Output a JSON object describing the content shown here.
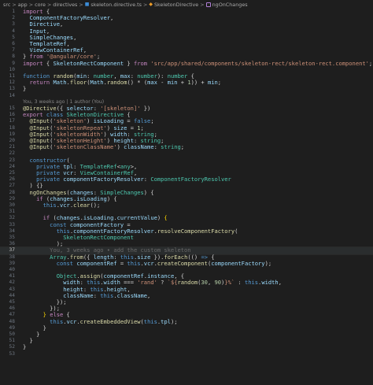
{
  "breadcrumb": {
    "items": [
      "src",
      "app",
      "core",
      "directives",
      "skeleton.directive.ts",
      "SkeletonDirective",
      "ngOnChanges"
    ],
    "separator": ">"
  },
  "blame": {
    "text": "You, 3 weeks ago | 1 author (You)"
  },
  "lines": [
    {
      "n": "1",
      "t": [
        [
          "kw",
          "import"
        ],
        [
          "pl",
          " {"
        ]
      ]
    },
    {
      "n": "2",
      "t": [
        [
          "pl",
          "  "
        ],
        [
          "var",
          "ComponentFactoryResolver"
        ],
        [
          "pl",
          ","
        ]
      ]
    },
    {
      "n": "3",
      "t": [
        [
          "pl",
          "  "
        ],
        [
          "var",
          "Directive"
        ],
        [
          "pl",
          ","
        ]
      ]
    },
    {
      "n": "4",
      "t": [
        [
          "pl",
          "  "
        ],
        [
          "var",
          "Input"
        ],
        [
          "pl",
          ","
        ]
      ]
    },
    {
      "n": "5",
      "t": [
        [
          "pl",
          "  "
        ],
        [
          "var",
          "SimpleChanges"
        ],
        [
          "pl",
          ","
        ]
      ]
    },
    {
      "n": "6",
      "t": [
        [
          "pl",
          "  "
        ],
        [
          "var",
          "TemplateRef"
        ],
        [
          "pl",
          ","
        ]
      ]
    },
    {
      "n": "7",
      "t": [
        [
          "pl",
          "  "
        ],
        [
          "var",
          "ViewContainerRef"
        ],
        [
          "pl",
          ","
        ]
      ]
    },
    {
      "n": "8",
      "t": [
        [
          "pl",
          "} "
        ],
        [
          "kw",
          "from"
        ],
        [
          "pl",
          " "
        ],
        [
          "str",
          "'@angular/core'"
        ],
        [
          "pl",
          ";"
        ]
      ]
    },
    {
      "n": "9",
      "t": [
        [
          "kw",
          "import"
        ],
        [
          "pl",
          " { "
        ],
        [
          "var",
          "SkeletonRectComponent"
        ],
        [
          "pl",
          " } "
        ],
        [
          "kw",
          "from"
        ],
        [
          "pl",
          " "
        ],
        [
          "str",
          "'src/app/shared/components/skeleton-rect/skeleton-rect.component'"
        ],
        [
          "pl",
          ";"
        ]
      ]
    },
    {
      "n": "10",
      "t": []
    },
    {
      "n": "11",
      "t": [
        [
          "kw2",
          "function"
        ],
        [
          "pl",
          " "
        ],
        [
          "fn",
          "random"
        ],
        [
          "pl",
          "("
        ],
        [
          "var",
          "min"
        ],
        [
          "pl",
          ": "
        ],
        [
          "ty",
          "number"
        ],
        [
          "pl",
          ", "
        ],
        [
          "var",
          "max"
        ],
        [
          "pl",
          ": "
        ],
        [
          "ty",
          "number"
        ],
        [
          "pl",
          "): "
        ],
        [
          "ty",
          "number"
        ],
        [
          "pl",
          " {"
        ]
      ]
    },
    {
      "n": "12",
      "t": [
        [
          "pl",
          "  "
        ],
        [
          "kw",
          "return"
        ],
        [
          "pl",
          " "
        ],
        [
          "var",
          "Math"
        ],
        [
          "pl",
          "."
        ],
        [
          "fn",
          "floor"
        ],
        [
          "pl",
          "("
        ],
        [
          "var",
          "Math"
        ],
        [
          "pl",
          "."
        ],
        [
          "fn",
          "random"
        ],
        [
          "pl",
          "() * ("
        ],
        [
          "var",
          "max"
        ],
        [
          "pl",
          " - "
        ],
        [
          "var",
          "min"
        ],
        [
          "pl",
          " + "
        ],
        [
          "num",
          "1"
        ],
        [
          "pl",
          ")) + "
        ],
        [
          "var",
          "min"
        ],
        [
          "pl",
          ";"
        ]
      ]
    },
    {
      "n": "13",
      "t": [
        [
          "pl",
          "}"
        ]
      ]
    },
    {
      "n": "14",
      "t": []
    },
    {
      "n": "15",
      "t": [
        [
          "fn",
          "@Directive"
        ],
        [
          "pl",
          "({ "
        ],
        [
          "var",
          "selector"
        ],
        [
          "pl",
          ": "
        ],
        [
          "str",
          "'[skeleton]'"
        ],
        [
          "pl",
          " })"
        ]
      ]
    },
    {
      "n": "16",
      "t": [
        [
          "kw",
          "export"
        ],
        [
          "pl",
          " "
        ],
        [
          "kw2",
          "class"
        ],
        [
          "pl",
          " "
        ],
        [
          "ty",
          "SkeletonDirective"
        ],
        [
          "pl",
          " {"
        ]
      ]
    },
    {
      "n": "17",
      "t": [
        [
          "pl",
          "  "
        ],
        [
          "fn",
          "@Input"
        ],
        [
          "pl",
          "("
        ],
        [
          "str",
          "'skeleton'"
        ],
        [
          "pl",
          ") "
        ],
        [
          "var",
          "isLoading"
        ],
        [
          "pl",
          " = "
        ],
        [
          "kw2",
          "false"
        ],
        [
          "pl",
          ";"
        ]
      ]
    },
    {
      "n": "18",
      "t": [
        [
          "pl",
          "  "
        ],
        [
          "fn",
          "@Input"
        ],
        [
          "pl",
          "("
        ],
        [
          "str",
          "'skeletonRepeat'"
        ],
        [
          "pl",
          ") "
        ],
        [
          "var",
          "size"
        ],
        [
          "pl",
          " = "
        ],
        [
          "num",
          "1"
        ],
        [
          "pl",
          ";"
        ]
      ]
    },
    {
      "n": "19",
      "t": [
        [
          "pl",
          "  "
        ],
        [
          "fn",
          "@Input"
        ],
        [
          "pl",
          "("
        ],
        [
          "str",
          "'skeletonWidth'"
        ],
        [
          "pl",
          ") "
        ],
        [
          "var",
          "width"
        ],
        [
          "pl",
          ": "
        ],
        [
          "ty",
          "string"
        ],
        [
          "pl",
          ";"
        ]
      ]
    },
    {
      "n": "20",
      "t": [
        [
          "pl",
          "  "
        ],
        [
          "fn",
          "@Input"
        ],
        [
          "pl",
          "("
        ],
        [
          "str",
          "'skeletonHeight'"
        ],
        [
          "pl",
          ") "
        ],
        [
          "var",
          "height"
        ],
        [
          "pl",
          ": "
        ],
        [
          "ty",
          "string"
        ],
        [
          "pl",
          ";"
        ]
      ]
    },
    {
      "n": "21",
      "t": [
        [
          "pl",
          "  "
        ],
        [
          "fn",
          "@Input"
        ],
        [
          "pl",
          "("
        ],
        [
          "str",
          "'skeletonClassName'"
        ],
        [
          "pl",
          ") "
        ],
        [
          "var",
          "className"
        ],
        [
          "pl",
          ": "
        ],
        [
          "ty",
          "string"
        ],
        [
          "pl",
          ";"
        ]
      ]
    },
    {
      "n": "22",
      "t": []
    },
    {
      "n": "23",
      "t": [
        [
          "pl",
          "  "
        ],
        [
          "kw2",
          "constructor"
        ],
        [
          "pl",
          "("
        ]
      ]
    },
    {
      "n": "24",
      "t": [
        [
          "pl",
          "    "
        ],
        [
          "kw2",
          "private"
        ],
        [
          "pl",
          " "
        ],
        [
          "var",
          "tpl"
        ],
        [
          "pl",
          ": "
        ],
        [
          "ty",
          "TemplateRef"
        ],
        [
          "pl",
          "<"
        ],
        [
          "ty",
          "any"
        ],
        [
          "pl",
          ">,"
        ]
      ]
    },
    {
      "n": "25",
      "t": [
        [
          "pl",
          "    "
        ],
        [
          "kw2",
          "private"
        ],
        [
          "pl",
          " "
        ],
        [
          "var",
          "vcr"
        ],
        [
          "pl",
          ": "
        ],
        [
          "ty",
          "ViewContainerRef"
        ],
        [
          "pl",
          ","
        ]
      ]
    },
    {
      "n": "26",
      "t": [
        [
          "pl",
          "    "
        ],
        [
          "kw2",
          "private"
        ],
        [
          "pl",
          " "
        ],
        [
          "var",
          "componentFactoryResolver"
        ],
        [
          "pl",
          ": "
        ],
        [
          "ty",
          "ComponentFactoryResolver"
        ]
      ]
    },
    {
      "n": "27",
      "t": [
        [
          "pl",
          "  ) {}"
        ]
      ]
    },
    {
      "n": "28",
      "t": [
        [
          "pl",
          "  "
        ],
        [
          "fn",
          "ngOnChanges"
        ],
        [
          "pl",
          "("
        ],
        [
          "var",
          "changes"
        ],
        [
          "pl",
          ": "
        ],
        [
          "ty",
          "SimpleChanges"
        ],
        [
          "pl",
          ") {"
        ]
      ]
    },
    {
      "n": "29",
      "t": [
        [
          "pl",
          "    "
        ],
        [
          "kw",
          "if"
        ],
        [
          "pl",
          " ("
        ],
        [
          "var",
          "changes"
        ],
        [
          "pl",
          "."
        ],
        [
          "var",
          "isLoading"
        ],
        [
          "pl",
          ") {"
        ]
      ]
    },
    {
      "n": "30",
      "t": [
        [
          "pl",
          "      "
        ],
        [
          "kw2",
          "this"
        ],
        [
          "pl",
          "."
        ],
        [
          "var",
          "vcr"
        ],
        [
          "pl",
          "."
        ],
        [
          "fn",
          "clear"
        ],
        [
          "pl",
          "();"
        ]
      ]
    },
    {
      "n": "31",
      "t": []
    },
    {
      "n": "32",
      "t": [
        [
          "pl",
          "      "
        ],
        [
          "kw",
          "if"
        ],
        [
          "pl",
          " ("
        ],
        [
          "var",
          "changes"
        ],
        [
          "pl",
          "."
        ],
        [
          "var",
          "isLoading"
        ],
        [
          "pl",
          "."
        ],
        [
          "var",
          "currentValue"
        ],
        [
          "pl",
          ") "
        ],
        [
          "br1",
          "{"
        ]
      ]
    },
    {
      "n": "33",
      "t": [
        [
          "pl",
          "        "
        ],
        [
          "kw2",
          "const"
        ],
        [
          "pl",
          " "
        ],
        [
          "var",
          "componentFactory"
        ],
        [
          "pl",
          " ="
        ]
      ]
    },
    {
      "n": "34",
      "t": [
        [
          "pl",
          "          "
        ],
        [
          "kw2",
          "this"
        ],
        [
          "pl",
          "."
        ],
        [
          "var",
          "componentFactoryResolver"
        ],
        [
          "pl",
          "."
        ],
        [
          "fn",
          "resolveComponentFactory"
        ],
        [
          "pl",
          "("
        ]
      ]
    },
    {
      "n": "35",
      "t": [
        [
          "pl",
          "            "
        ],
        [
          "ty",
          "SkeletonRectComponent"
        ]
      ]
    },
    {
      "n": "36",
      "t": [
        [
          "pl",
          "          );"
        ]
      ]
    },
    {
      "n": "37",
      "t": [
        [
          "pl",
          "        "
        ],
        [
          "ghost",
          "You, 3 weeks ago • add the custom skeleton"
        ]
      ],
      "current": true
    },
    {
      "n": "38",
      "t": [
        [
          "pl",
          "        "
        ],
        [
          "ty",
          "Array"
        ],
        [
          "pl",
          "."
        ],
        [
          "fn",
          "from"
        ],
        [
          "pl",
          "({ "
        ],
        [
          "var",
          "length"
        ],
        [
          "pl",
          ": "
        ],
        [
          "kw2",
          "this"
        ],
        [
          "pl",
          "."
        ],
        [
          "var",
          "size"
        ],
        [
          "pl",
          " })."
        ],
        [
          "fn",
          "forEach"
        ],
        [
          "pl",
          "(() "
        ],
        [
          "kw2",
          "=>"
        ],
        [
          "pl",
          " {"
        ]
      ]
    },
    {
      "n": "39",
      "t": [
        [
          "pl",
          "          "
        ],
        [
          "kw2",
          "const"
        ],
        [
          "pl",
          " "
        ],
        [
          "var",
          "componentRef"
        ],
        [
          "pl",
          " = "
        ],
        [
          "kw2",
          "this"
        ],
        [
          "pl",
          "."
        ],
        [
          "var",
          "vcr"
        ],
        [
          "pl",
          "."
        ],
        [
          "fn",
          "createComponent"
        ],
        [
          "pl",
          "("
        ],
        [
          "var",
          "componentFactory"
        ],
        [
          "pl",
          ");"
        ]
      ]
    },
    {
      "n": "40",
      "t": []
    },
    {
      "n": "41",
      "t": [
        [
          "pl",
          "          "
        ],
        [
          "ty",
          "Object"
        ],
        [
          "pl",
          "."
        ],
        [
          "fn",
          "assign"
        ],
        [
          "pl",
          "("
        ],
        [
          "var",
          "componentRef"
        ],
        [
          "pl",
          "."
        ],
        [
          "var",
          "instance"
        ],
        [
          "pl",
          ", {"
        ]
      ]
    },
    {
      "n": "42",
      "t": [
        [
          "pl",
          "            "
        ],
        [
          "var",
          "width"
        ],
        [
          "pl",
          ": "
        ],
        [
          "kw2",
          "this"
        ],
        [
          "pl",
          "."
        ],
        [
          "var",
          "width"
        ],
        [
          "pl",
          " === "
        ],
        [
          "str",
          "'rand'"
        ],
        [
          "pl",
          " ? "
        ],
        [
          "str",
          "`${"
        ],
        [
          "fn",
          "random"
        ],
        [
          "pl",
          "("
        ],
        [
          "num",
          "30"
        ],
        [
          "pl",
          ", "
        ],
        [
          "num",
          "90"
        ],
        [
          "pl",
          ")"
        ],
        [
          "str",
          "}%`"
        ],
        [
          "pl",
          " : "
        ],
        [
          "kw2",
          "this"
        ],
        [
          "pl",
          "."
        ],
        [
          "var",
          "width"
        ],
        [
          "pl",
          ","
        ]
      ]
    },
    {
      "n": "43",
      "t": [
        [
          "pl",
          "            "
        ],
        [
          "var",
          "height"
        ],
        [
          "pl",
          ": "
        ],
        [
          "kw2",
          "this"
        ],
        [
          "pl",
          "."
        ],
        [
          "var",
          "height"
        ],
        [
          "pl",
          ","
        ]
      ]
    },
    {
      "n": "44",
      "t": [
        [
          "pl",
          "            "
        ],
        [
          "var",
          "className"
        ],
        [
          "pl",
          ": "
        ],
        [
          "kw2",
          "this"
        ],
        [
          "pl",
          "."
        ],
        [
          "var",
          "className"
        ],
        [
          "pl",
          ","
        ]
      ]
    },
    {
      "n": "45",
      "t": [
        [
          "pl",
          "          });"
        ]
      ]
    },
    {
      "n": "46",
      "t": [
        [
          "pl",
          "        });"
        ]
      ]
    },
    {
      "n": "47",
      "t": [
        [
          "pl",
          "      "
        ],
        [
          "br1",
          "}"
        ],
        [
          "pl",
          " "
        ],
        [
          "kw",
          "else"
        ],
        [
          "pl",
          " {"
        ]
      ]
    },
    {
      "n": "48",
      "t": [
        [
          "pl",
          "        "
        ],
        [
          "kw2",
          "this"
        ],
        [
          "pl",
          "."
        ],
        [
          "var",
          "vcr"
        ],
        [
          "pl",
          "."
        ],
        [
          "fn",
          "createEmbeddedView"
        ],
        [
          "pl",
          "("
        ],
        [
          "kw2",
          "this"
        ],
        [
          "pl",
          "."
        ],
        [
          "var",
          "tpl"
        ],
        [
          "pl",
          ");"
        ]
      ]
    },
    {
      "n": "49",
      "t": [
        [
          "pl",
          "      }"
        ]
      ]
    },
    {
      "n": "50",
      "t": [
        [
          "pl",
          "    }"
        ]
      ]
    },
    {
      "n": "51",
      "t": [
        [
          "pl",
          "  }"
        ]
      ]
    },
    {
      "n": "52",
      "t": [
        [
          "pl",
          "}"
        ]
      ]
    },
    {
      "n": "53",
      "t": []
    }
  ]
}
